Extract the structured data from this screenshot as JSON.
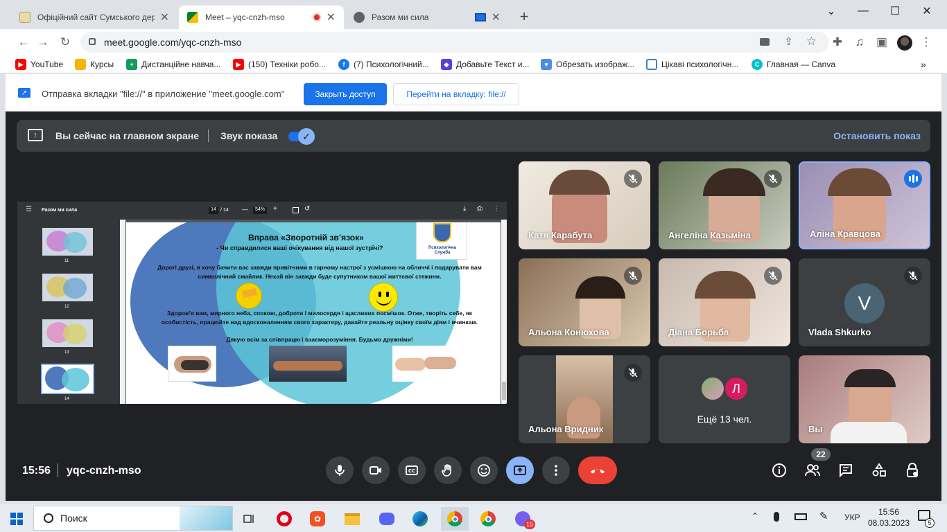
{
  "tabs": [
    {
      "title": "Офіційний сайт Сумського держ",
      "active": false
    },
    {
      "title": "Meet – yqc-cnzh-mso",
      "active": true
    },
    {
      "title": "Разом ми сила",
      "active": false
    }
  ],
  "address": {
    "url": "meet.google.com/yqc-cnzh-mso"
  },
  "bookmarks": [
    "YouTube",
    "Курсы",
    "Дистанційне навча...",
    "(150) Техніки робо...",
    "(7) Психологічний...",
    "Добавьте Текст и...",
    "Обрезать изображ...",
    "Цікаві психологічн...",
    "Главная — Canva"
  ],
  "infobar": {
    "message": "Отправка вкладки \"file://\" в приложение \"meet.google.com\"",
    "stop_button": "Закрыть доступ",
    "switch_button": "Перейти на вкладку: file://"
  },
  "presenting": {
    "label": "Вы сейчас на главном экране",
    "audio_label": "Звук показа",
    "stop_label": "Остановить показ"
  },
  "pdf": {
    "title": "Разом ми сила",
    "page": "14",
    "page_total": "/ 14",
    "zoom": "54%",
    "thumbnails": [
      "11",
      "12",
      "13",
      "14"
    ],
    "slide": {
      "heading": "Вправа «Зворотній зв’язок»",
      "question": "- Чи справдилися ваші очікування від нашої зустрічі?",
      "logo_text_1": "Психологічна",
      "logo_text_2": "Служба",
      "para1": "Дорогі друзі, я хочу бачити вас завжди привітними  в гарному настрої з усмішкою на обличчі і подарувати вам символічний смайлик. Нехай він завжди буде супутником вашої життєвої стежини.",
      "para2": "Здоров’я вам, мирного неба, спокою, доброти і милосердя  і щасливих посмішок. Отже, творіть себе, як особистість, працюйте над вдосконаленням свого характеру, давайте реальну оцінку своїм діям і вчинкам.",
      "para3": "Дякую всім за співпрацю і взаєморозуміння. Будьмо дружніми!"
    }
  },
  "participants": [
    {
      "name": "Катя Карабута",
      "muted": true
    },
    {
      "name": "Ангеліна Казьміна",
      "muted": true
    },
    {
      "name": "Аліна Кравцова",
      "speaking": true
    },
    {
      "name": "Альона Конюхова",
      "muted": true
    },
    {
      "name": "Діана Борьба",
      "muted": true
    },
    {
      "name": "Vlada Shkurko",
      "initial": "V",
      "muted": true
    },
    {
      "name": "Альона Вридник",
      "muted": true
    },
    {
      "name": "Ещё 13 чел.",
      "initial": "Л"
    },
    {
      "name": "Вы"
    }
  ],
  "footer": {
    "time": "15:56",
    "meeting_code": "yqc-cnzh-mso",
    "participant_count": "22"
  },
  "taskbar": {
    "search": "Поиск",
    "lang": "УКР",
    "time": "15:56",
    "date": "08.03.2023",
    "viber_badge": "15",
    "notif_badge": "5"
  },
  "colors": {
    "accent": "#8ab4f8",
    "end_call": "#ea4335",
    "present_active": "#8ab4f8"
  }
}
